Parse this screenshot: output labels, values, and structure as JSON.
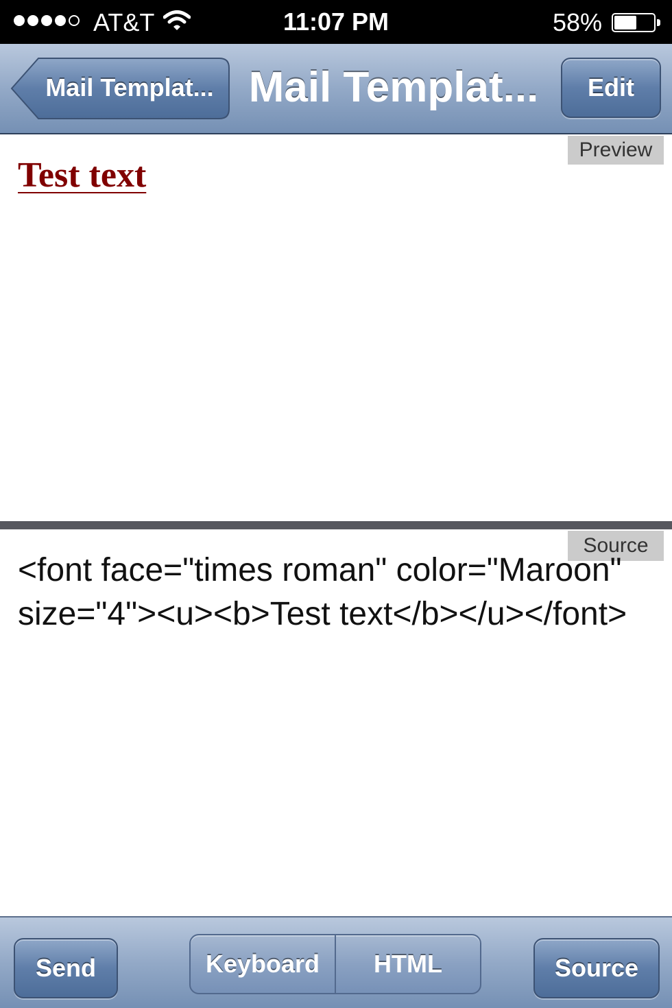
{
  "status_bar": {
    "carrier": "AT&T",
    "signal_bars_filled": 4,
    "signal_bars_total": 5,
    "time": "11:07 PM",
    "battery_percent": "58%",
    "battery_level": 0.58,
    "wifi_icon": "wifi-icon",
    "battery_icon": "battery-icon"
  },
  "nav_bar": {
    "back_label": "Mail Templat...",
    "title": "Mail Templat...",
    "edit_label": "Edit"
  },
  "preview": {
    "tag": "Preview",
    "text": "Test text",
    "text_color": "#800000"
  },
  "source": {
    "tag": "Source",
    "html": "<font face=\"times roman\" color=\"Maroon\" size=\"4\"><u><b>Test text</b></u></font>"
  },
  "toolbar": {
    "send_label": "Send",
    "segments": [
      {
        "label": "Keyboard"
      },
      {
        "label": "HTML"
      }
    ],
    "source_label": "Source"
  },
  "colors": {
    "nav_bar_gradient_top": "#b9c8dd",
    "nav_bar_gradient_bottom": "#7590b4",
    "button_blue": "#5f7ea9",
    "tag_gray": "#cbcbcb",
    "divider": "#56575e"
  }
}
